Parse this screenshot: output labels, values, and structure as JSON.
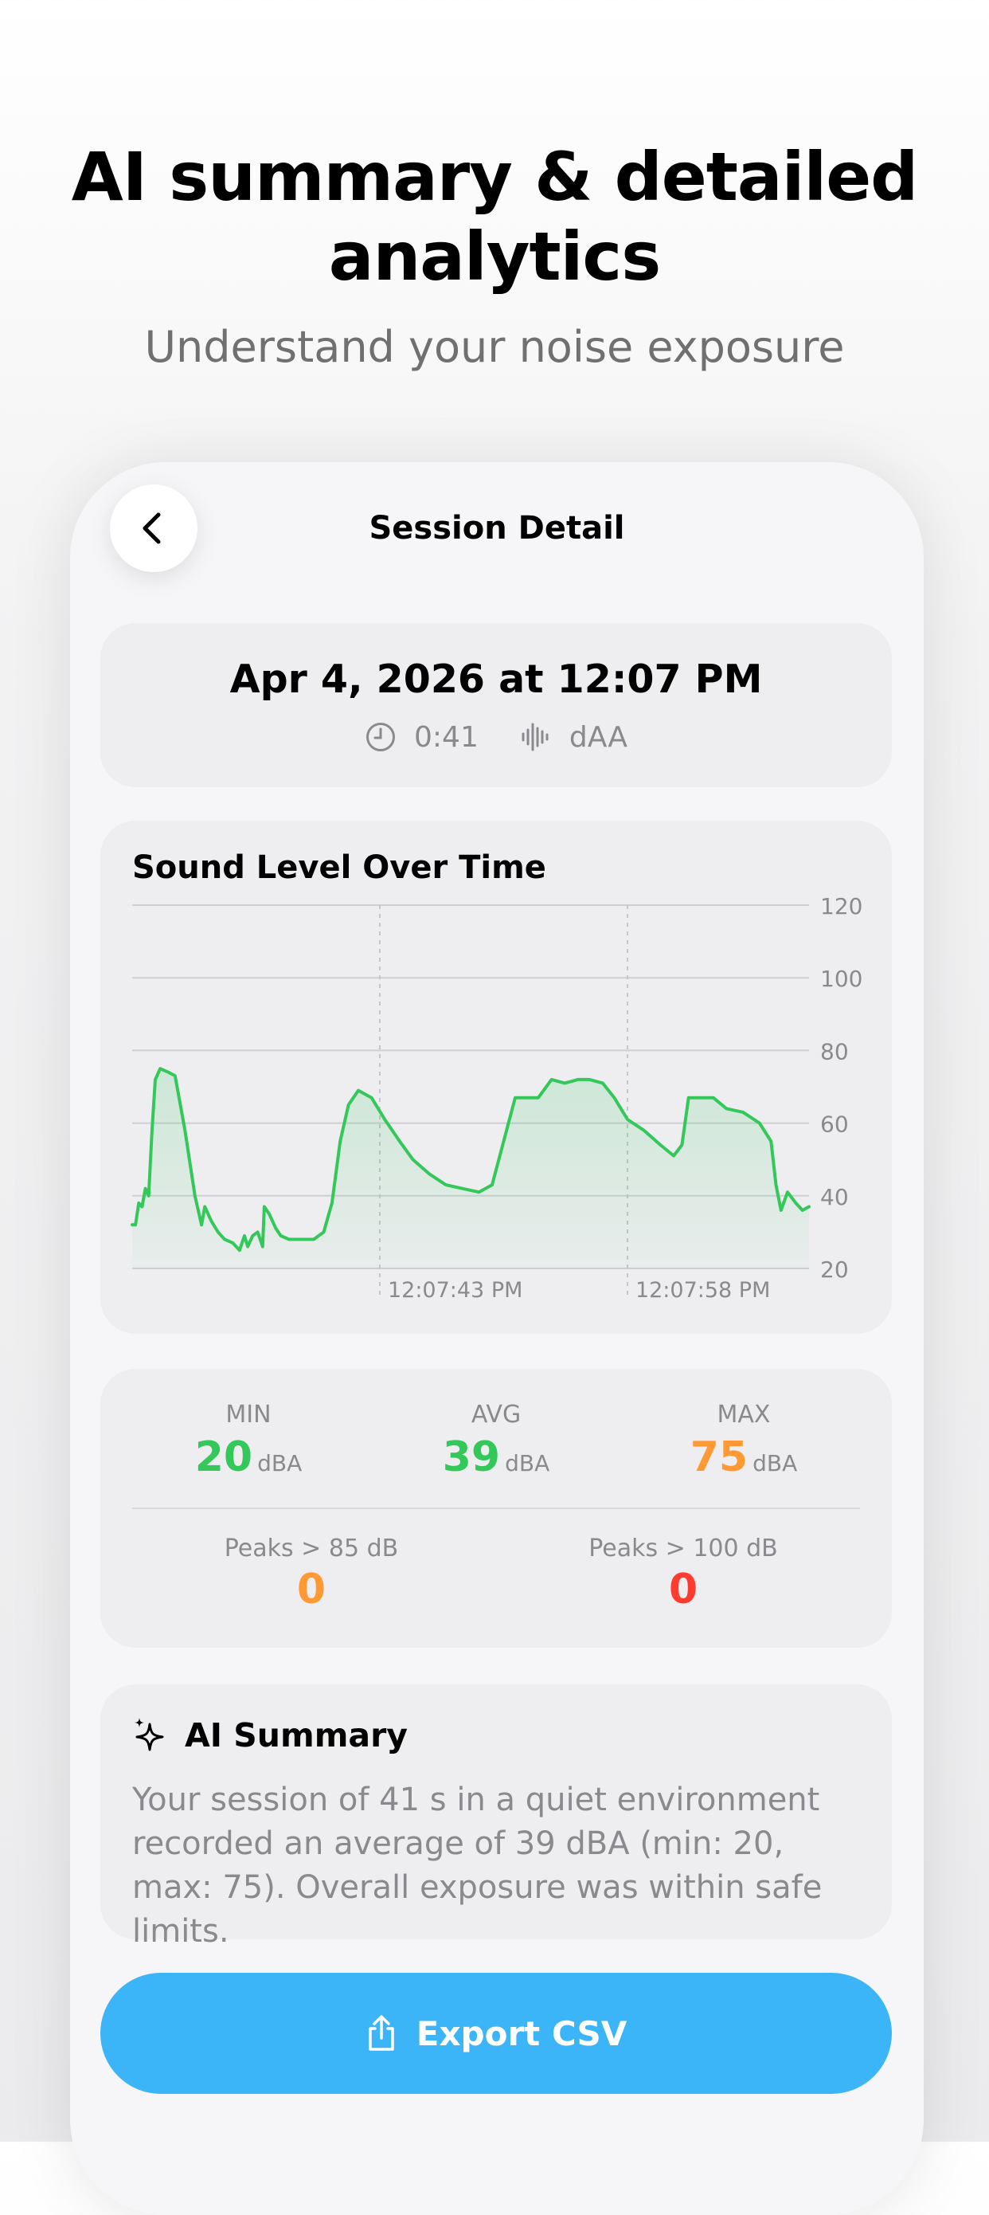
{
  "headline": {
    "title_line1": "AI summary & detailed",
    "title_line2": "analytics",
    "subtitle": "Understand your noise exposure"
  },
  "nav": {
    "title": "Session Detail",
    "back_icon": "chevron-left-icon"
  },
  "session": {
    "date": "Apr 4, 2026 at 12:07 PM",
    "duration": "0:41",
    "weighting": "dAA",
    "duration_icon": "clock-icon",
    "weighting_icon": "waveform-icon"
  },
  "chart": {
    "title": "Sound Level Over Time"
  },
  "chart_data": {
    "type": "area",
    "title": "Sound Level Over Time",
    "xlabel": "",
    "ylabel": "",
    "ylim": [
      20,
      120
    ],
    "y_ticks": [
      "120",
      "100",
      "80",
      "60",
      "40",
      "20"
    ],
    "y_tick_values": [
      120,
      100,
      80,
      60,
      40,
      20
    ],
    "x_tick_labels": [
      "12:07:43 PM",
      "12:07:58 PM"
    ],
    "x_tick_positions_s": [
      15,
      30
    ],
    "xlim_s": [
      0,
      41
    ],
    "grid": true,
    "color": "#34c759",
    "series": [
      {
        "values": [
          [
            0.0,
            32
          ],
          [
            0.2,
            32
          ],
          [
            0.4,
            38
          ],
          [
            0.6,
            37
          ],
          [
            0.8,
            42
          ],
          [
            1.0,
            40
          ],
          [
            1.2,
            58
          ],
          [
            1.4,
            72
          ],
          [
            1.7,
            75
          ],
          [
            2.2,
            74
          ],
          [
            2.6,
            73
          ],
          [
            3.2,
            58
          ],
          [
            3.8,
            40
          ],
          [
            4.2,
            32
          ],
          [
            4.4,
            37
          ],
          [
            4.8,
            33
          ],
          [
            5.2,
            30
          ],
          [
            5.6,
            28
          ],
          [
            6.1,
            27
          ],
          [
            6.5,
            25
          ],
          [
            6.8,
            29
          ],
          [
            7.0,
            26
          ],
          [
            7.3,
            29
          ],
          [
            7.6,
            30
          ],
          [
            7.9,
            26
          ],
          [
            8.0,
            37
          ],
          [
            8.3,
            35
          ],
          [
            8.7,
            31
          ],
          [
            9.0,
            29
          ],
          [
            9.5,
            28
          ],
          [
            10.3,
            28
          ],
          [
            11.0,
            28
          ],
          [
            11.6,
            30
          ],
          [
            12.1,
            38
          ],
          [
            12.6,
            55
          ],
          [
            13.1,
            65
          ],
          [
            13.7,
            69
          ],
          [
            14.5,
            67
          ],
          [
            15.3,
            61
          ],
          [
            16.2,
            55
          ],
          [
            17.0,
            50
          ],
          [
            18.0,
            46
          ],
          [
            19.0,
            43
          ],
          [
            20.0,
            42
          ],
          [
            21.0,
            41
          ],
          [
            21.8,
            43
          ],
          [
            22.5,
            55
          ],
          [
            23.2,
            67
          ],
          [
            24.0,
            67
          ],
          [
            24.6,
            67
          ],
          [
            25.4,
            72
          ],
          [
            26.2,
            71
          ],
          [
            27.0,
            72
          ],
          [
            27.7,
            72
          ],
          [
            28.5,
            71
          ],
          [
            29.2,
            67
          ],
          [
            30.0,
            61
          ],
          [
            31.0,
            58
          ],
          [
            32.0,
            54
          ],
          [
            32.8,
            51
          ],
          [
            33.3,
            54
          ],
          [
            33.7,
            67
          ],
          [
            34.5,
            67
          ],
          [
            35.2,
            67
          ],
          [
            36.0,
            64
          ],
          [
            37.0,
            63
          ],
          [
            38.0,
            60
          ],
          [
            38.7,
            55
          ],
          [
            39.0,
            43
          ],
          [
            39.3,
            36
          ],
          [
            39.7,
            41
          ],
          [
            40.2,
            38
          ],
          [
            40.6,
            36
          ],
          [
            41.0,
            37
          ]
        ]
      }
    ]
  },
  "stats": {
    "min_label": "MIN",
    "min_value": "20",
    "avg_label": "AVG",
    "avg_value": "39",
    "max_label": "MAX",
    "max_value": "75",
    "unit": "dBA",
    "peaks85_label": "Peaks > 85 dB",
    "peaks85_value": "0",
    "peaks100_label": "Peaks > 100 dB",
    "peaks100_value": "0",
    "colors": {
      "green": "#34c759",
      "orange": "#ff9933",
      "red": "#ff3b30"
    }
  },
  "summary": {
    "title": "AI Summary",
    "icon": "sparkles-icon",
    "text": "Your session of 41 s in a quiet environment recorded an average of 39 dBA (min: 20, max: 75). Overall exposure was within safe limits."
  },
  "export": {
    "label": "Export CSV",
    "icon": "share-icon",
    "color": "#3bb4f8"
  }
}
